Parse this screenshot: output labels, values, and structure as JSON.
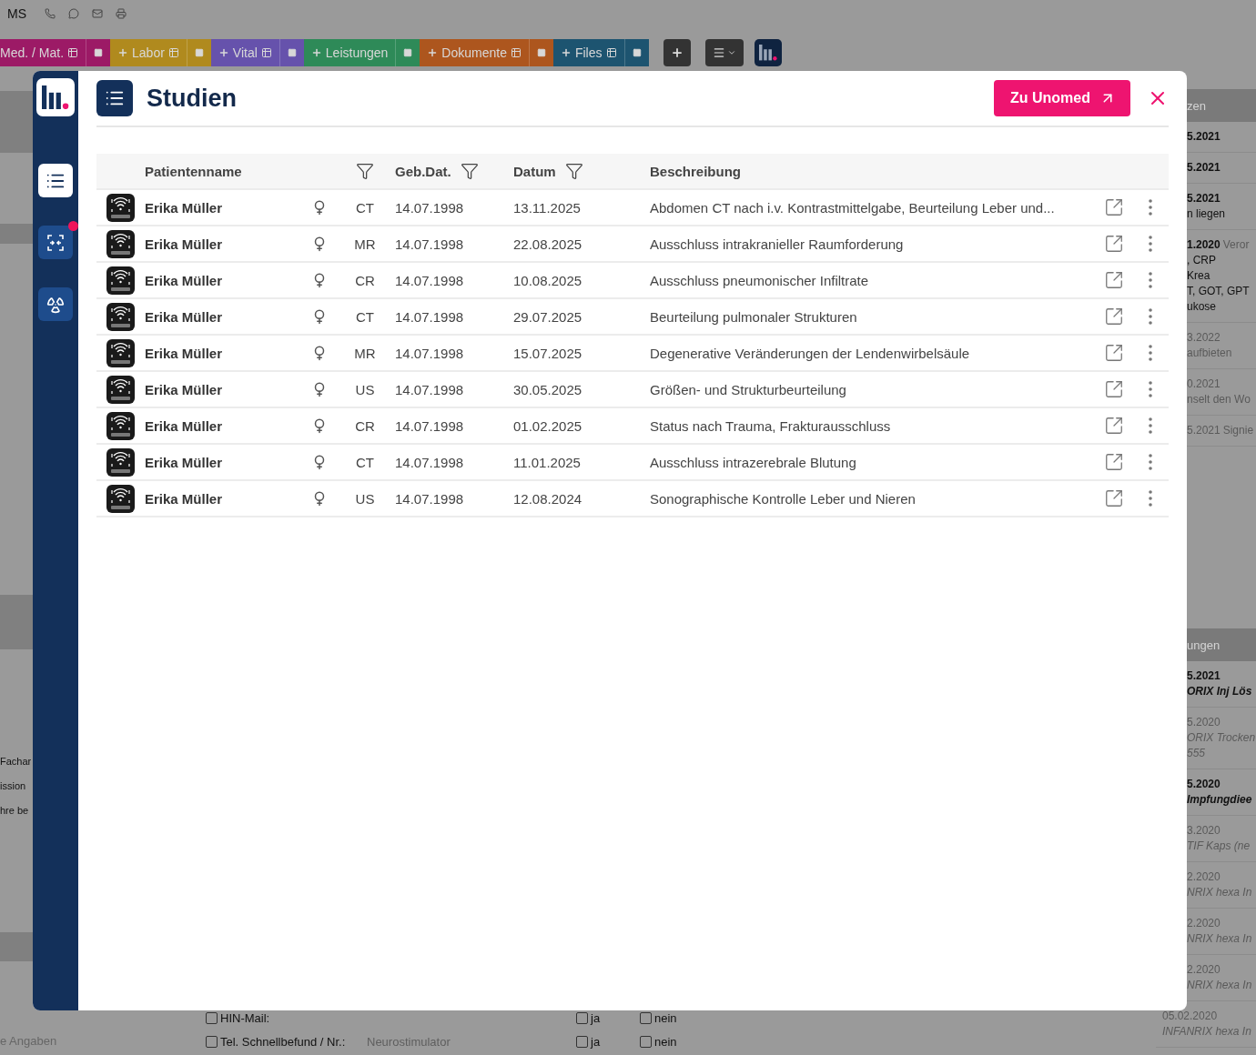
{
  "app_header": {
    "initials": "MS"
  },
  "module_tabs": [
    {
      "label": "Med. / Mat.",
      "color": "#9c1a66",
      "plus": false,
      "list_icon": true
    },
    {
      "label": "Labor",
      "color": "#b08a1e",
      "plus": true,
      "list_icon": true
    },
    {
      "label": "Vital",
      "color": "#6652ac",
      "plus": true,
      "list_icon": true
    },
    {
      "label": "Leistungen",
      "color": "#2e8a58",
      "plus": true,
      "list_icon": false
    },
    {
      "label": "Dokumente",
      "color": "#ad561e",
      "plus": true,
      "list_icon": true
    },
    {
      "label": "Files",
      "color": "#1d5470",
      "plus": true,
      "list_icon": true
    }
  ],
  "left_fragments": [
    "Fachar",
    "ission",
    "hre be"
  ],
  "left_footer": "e Angaben",
  "right_sections": [
    {
      "header": "zen",
      "entries": [
        {
          "date": "5.2021",
          "muted": false,
          "clipped": true
        },
        {
          "date": "5.2021",
          "muted": false,
          "clipped": true
        },
        {
          "date": "5.2021",
          "muted": false,
          "clipped": true,
          "lines": [
            "n liegen"
          ]
        },
        {
          "date": "1.2020",
          "muted": false,
          "clipped": true,
          "note": "Veror",
          "lines": [
            ", CRP",
            "Krea",
            "T, GOT, GPT",
            "ukose"
          ]
        },
        {
          "date": "3.2022",
          "muted": true,
          "clipped": true,
          "lines": [
            "aufbieten"
          ]
        },
        {
          "date": "0.2021",
          "muted": true,
          "clipped": true,
          "lines": [
            "nselt den Wo"
          ]
        },
        {
          "date": "5.2021",
          "muted": true,
          "clipped": true,
          "note": "Signie"
        }
      ]
    },
    {
      "header": "ungen",
      "entries": [
        {
          "date": "5.2021",
          "muted": false,
          "clipped": true,
          "lines": [
            "ORIX Inj Lös"
          ]
        },
        {
          "date": "5.2020",
          "muted": true,
          "clipped": true,
          "lines": [
            "ORIX Trocken",
            "555"
          ]
        },
        {
          "date": "5.2020",
          "muted": false,
          "clipped": true,
          "lines": [
            "Impfungdiee"
          ]
        },
        {
          "date": "3.2020",
          "muted": true,
          "clipped": true,
          "lines": [
            "TIF Kaps (ne"
          ]
        },
        {
          "date": "2.2020",
          "muted": true,
          "clipped": true,
          "lines": [
            "NRIX hexa In"
          ]
        },
        {
          "date": "2.2020",
          "muted": true,
          "clipped": true,
          "lines": [
            "NRIX hexa In"
          ]
        },
        {
          "date": "2.2020",
          "muted": true,
          "clipped": true,
          "lines": [
            "NRIX hexa In"
          ]
        },
        {
          "date": "05.02.2020",
          "muted": true,
          "clipped": false,
          "lines": [
            "INFANRIX hexa In"
          ]
        }
      ]
    }
  ],
  "form_rows": [
    {
      "label": "HIN-Mail:",
      "checked": false,
      "options": [
        {
          "label": "ja",
          "checked": false
        },
        {
          "label": "nein",
          "checked": false
        }
      ]
    },
    {
      "label": "Tel. Schnellbefund / Nr.:",
      "checked": false,
      "note": "Neurostimulator",
      "options": [
        {
          "label": "ja",
          "checked": false
        },
        {
          "label": "nein",
          "checked": false
        }
      ]
    }
  ],
  "modal": {
    "sidebar": [
      {
        "kind": "list",
        "selected": true,
        "badge": false
      },
      {
        "kind": "scan",
        "selected": false,
        "badge": true
      },
      {
        "kind": "radiation",
        "selected": false,
        "badge": false
      }
    ],
    "title": "Studien",
    "action_button": "Zu Unomed",
    "columns": {
      "name": "Patientenname",
      "dob": "Geb.Dat.",
      "date": "Datum",
      "description": "Beschreibung"
    },
    "rows": [
      {
        "name": "Erika Müller",
        "modality": "CT",
        "dob": "14.07.1998",
        "date": "13.11.2025",
        "description": "Abdomen CT nach i.v. Kontrastmittelgabe, Beurteilung Leber und..."
      },
      {
        "name": "Erika Müller",
        "modality": "MR",
        "dob": "14.07.1998",
        "date": "22.08.2025",
        "description": "Ausschluss intrakranieller Raumforderung"
      },
      {
        "name": "Erika Müller",
        "modality": "CR",
        "dob": "14.07.1998",
        "date": "10.08.2025",
        "description": "Ausschluss pneumonischer Infiltrate"
      },
      {
        "name": "Erika Müller",
        "modality": "CT",
        "dob": "14.07.1998",
        "date": "29.07.2025",
        "description": "Beurteilung pulmonaler Strukturen"
      },
      {
        "name": "Erika Müller",
        "modality": "MR",
        "dob": "14.07.1998",
        "date": "15.07.2025",
        "description": "Degenerative Veränderungen der Lendenwirbelsäule"
      },
      {
        "name": "Erika Müller",
        "modality": "US",
        "dob": "14.07.1998",
        "date": "30.05.2025",
        "description": "Größen- und Strukturbeurteilung"
      },
      {
        "name": "Erika Müller",
        "modality": "CR",
        "dob": "14.07.1998",
        "date": "01.02.2025",
        "description": "Status nach Trauma, Frakturausschluss"
      },
      {
        "name": "Erika Müller",
        "modality": "CT",
        "dob": "14.07.1998",
        "date": "11.01.2025",
        "description": "Ausschluss intrazerebrale Blutung"
      },
      {
        "name": "Erika Müller",
        "modality": "US",
        "dob": "14.07.1998",
        "date": "12.08.2024",
        "description": "Sonographische Kontrolle Leber und Nieren"
      }
    ]
  }
}
